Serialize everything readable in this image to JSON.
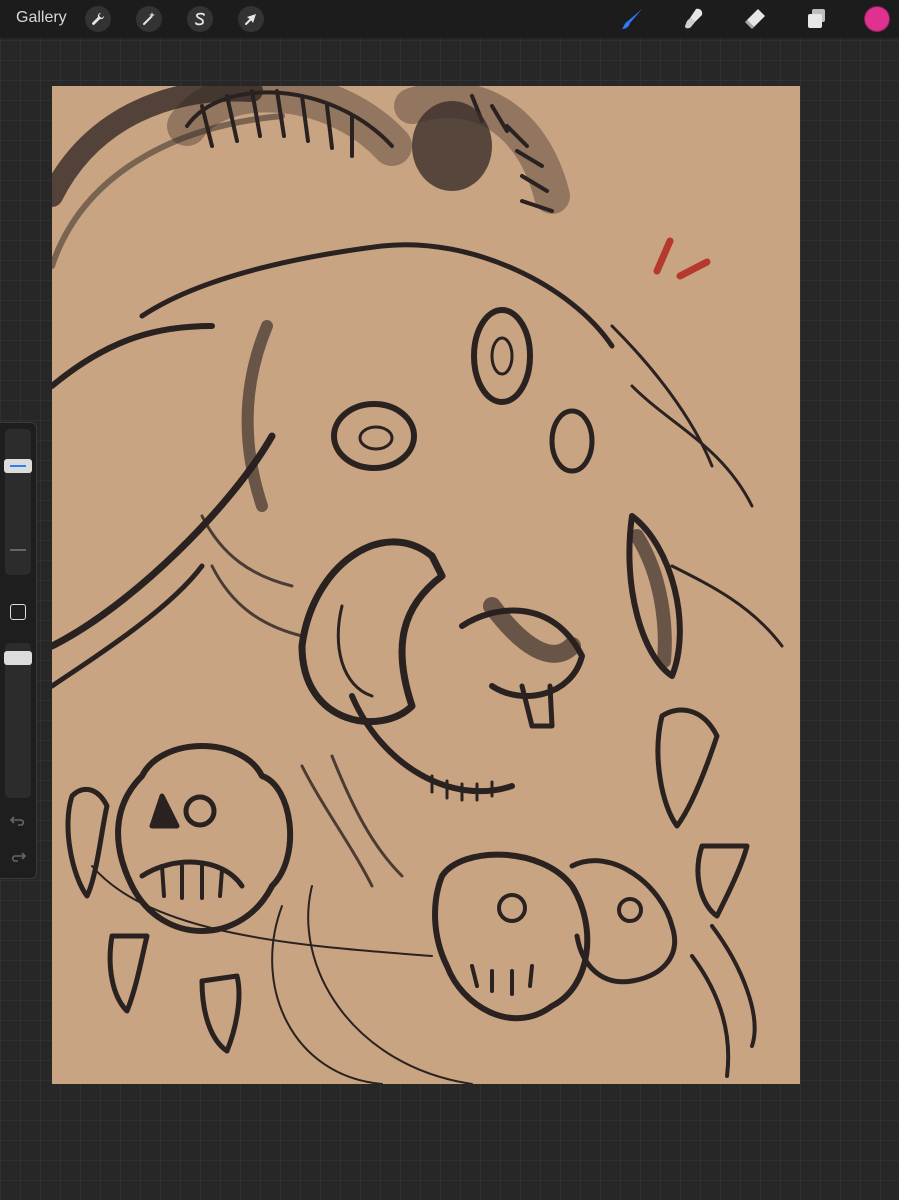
{
  "app": {
    "gallery_label": "Gallery"
  },
  "toolbar_left": [
    {
      "name": "actions",
      "icon": "wrench-icon"
    },
    {
      "name": "adjustments",
      "icon": "magic-wand-icon"
    },
    {
      "name": "selection",
      "icon": "selection-s-icon"
    },
    {
      "name": "transform",
      "icon": "arrow-cursor-icon"
    }
  ],
  "toolbar_right": [
    {
      "name": "brush",
      "icon": "brush-icon",
      "active": true
    },
    {
      "name": "smudge",
      "icon": "smudge-icon",
      "active": false
    },
    {
      "name": "eraser",
      "icon": "eraser-icon",
      "active": false
    },
    {
      "name": "layers",
      "icon": "layers-icon",
      "active": false
    },
    {
      "name": "color",
      "icon": "color-swatch",
      "value": "#e0318f"
    }
  ],
  "sidebar": {
    "brush_size_level": 0.77,
    "opacity_level": 0.94,
    "undo_icon": "undo-icon",
    "redo_icon": "redo-icon",
    "modify_button_icon": "square-icon"
  },
  "colors": {
    "accent_blue": "#2f7cf6",
    "canvas_bg": "#c9a482",
    "ink": "#2a2220",
    "red_marks": "#b5392c"
  }
}
